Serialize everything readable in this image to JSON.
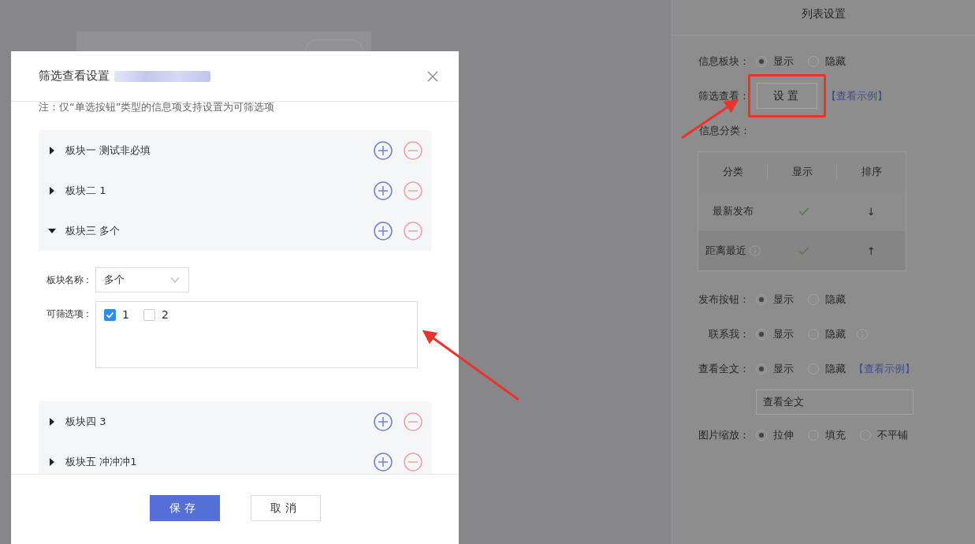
{
  "modal": {
    "title": "筛选查看设置",
    "note": "注：仅“单选按钮”类型的信息项支持设置为可筛选项",
    "sections": [
      {
        "name": "板块一 测试非必填",
        "expanded": false
      },
      {
        "name": "板块二 1",
        "expanded": false
      },
      {
        "name": "板块三 多个",
        "expanded": true,
        "name_label": "板块名称：",
        "name_value": "多个",
        "options_label": "可筛选项：",
        "options": [
          {
            "label": "1",
            "checked": true
          },
          {
            "label": "2",
            "checked": false
          }
        ]
      },
      {
        "name": "板块四 3",
        "expanded": false
      },
      {
        "name": "板块五 冲冲冲1",
        "expanded": false
      }
    ],
    "buttons": [
      {
        "label": "保存",
        "kind": "primary"
      },
      {
        "label": "取消",
        "kind": "default"
      }
    ]
  },
  "settings_panel": {
    "title": "列表设置",
    "rows": [
      {
        "kind": "radio",
        "label": "信息板块：",
        "options": [
          {
            "label": "显示",
            "selected": true
          },
          {
            "label": "隐藏",
            "selected": false
          }
        ]
      },
      {
        "kind": "button",
        "label": "筛选查看：",
        "button": "设置",
        "link": "【查看示例】",
        "highlighted": true
      },
      {
        "kind": "table",
        "label": "信息分类：",
        "columns": [
          "分类",
          "显示",
          "排序"
        ],
        "rows": [
          {
            "name": "最新发布",
            "info": false,
            "shown": true,
            "sort": "↓"
          },
          {
            "name": "距离最近",
            "info": true,
            "shown": true,
            "sort": "↑"
          }
        ]
      },
      {
        "kind": "radio",
        "label": "发布按钮：",
        "options": [
          {
            "label": "显示",
            "selected": true
          },
          {
            "label": "隐藏",
            "selected": false
          }
        ]
      },
      {
        "kind": "radio",
        "label": "联系我：",
        "info": true,
        "options": [
          {
            "label": "显示",
            "selected": true
          },
          {
            "label": "隐藏",
            "selected": false
          }
        ]
      },
      {
        "kind": "radio",
        "label": "查看全文：",
        "link": "【查看示例】",
        "value": "查看全文",
        "options": [
          {
            "label": "显示",
            "selected": true
          },
          {
            "label": "隐藏",
            "selected": false
          }
        ]
      },
      {
        "kind": "radio",
        "label": "图片缩放：",
        "options": [
          {
            "label": "拉伸",
            "selected": true
          },
          {
            "label": "填充",
            "selected": false
          },
          {
            "label": "不平铺",
            "selected": false
          }
        ]
      }
    ]
  }
}
